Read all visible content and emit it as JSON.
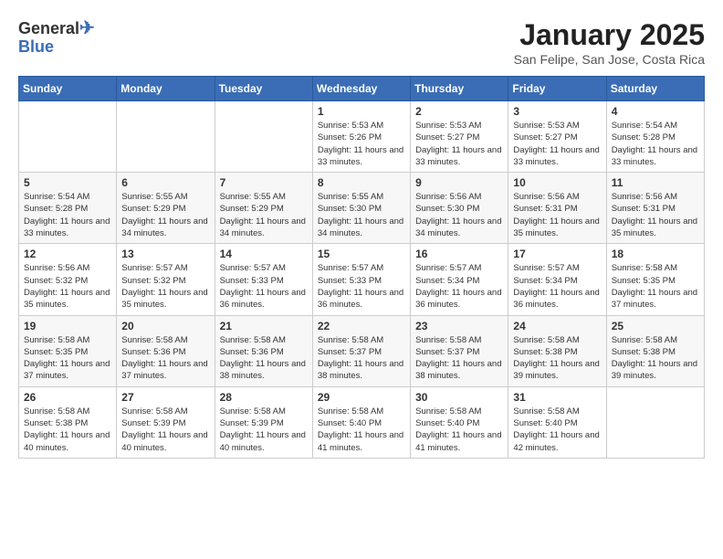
{
  "header": {
    "logo_line1": "General",
    "logo_line2": "Blue",
    "month_title": "January 2025",
    "subtitle": "San Felipe, San Jose, Costa Rica"
  },
  "weekdays": [
    "Sunday",
    "Monday",
    "Tuesday",
    "Wednesday",
    "Thursday",
    "Friday",
    "Saturday"
  ],
  "weeks": [
    [
      {
        "day": "",
        "info": ""
      },
      {
        "day": "",
        "info": ""
      },
      {
        "day": "",
        "info": ""
      },
      {
        "day": "1",
        "info": "Sunrise: 5:53 AM\nSunset: 5:26 PM\nDaylight: 11 hours\nand 33 minutes."
      },
      {
        "day": "2",
        "info": "Sunrise: 5:53 AM\nSunset: 5:27 PM\nDaylight: 11 hours\nand 33 minutes."
      },
      {
        "day": "3",
        "info": "Sunrise: 5:53 AM\nSunset: 5:27 PM\nDaylight: 11 hours\nand 33 minutes."
      },
      {
        "day": "4",
        "info": "Sunrise: 5:54 AM\nSunset: 5:28 PM\nDaylight: 11 hours\nand 33 minutes."
      }
    ],
    [
      {
        "day": "5",
        "info": "Sunrise: 5:54 AM\nSunset: 5:28 PM\nDaylight: 11 hours\nand 33 minutes."
      },
      {
        "day": "6",
        "info": "Sunrise: 5:55 AM\nSunset: 5:29 PM\nDaylight: 11 hours\nand 34 minutes."
      },
      {
        "day": "7",
        "info": "Sunrise: 5:55 AM\nSunset: 5:29 PM\nDaylight: 11 hours\nand 34 minutes."
      },
      {
        "day": "8",
        "info": "Sunrise: 5:55 AM\nSunset: 5:30 PM\nDaylight: 11 hours\nand 34 minutes."
      },
      {
        "day": "9",
        "info": "Sunrise: 5:56 AM\nSunset: 5:30 PM\nDaylight: 11 hours\nand 34 minutes."
      },
      {
        "day": "10",
        "info": "Sunrise: 5:56 AM\nSunset: 5:31 PM\nDaylight: 11 hours\nand 35 minutes."
      },
      {
        "day": "11",
        "info": "Sunrise: 5:56 AM\nSunset: 5:31 PM\nDaylight: 11 hours\nand 35 minutes."
      }
    ],
    [
      {
        "day": "12",
        "info": "Sunrise: 5:56 AM\nSunset: 5:32 PM\nDaylight: 11 hours\nand 35 minutes."
      },
      {
        "day": "13",
        "info": "Sunrise: 5:57 AM\nSunset: 5:32 PM\nDaylight: 11 hours\nand 35 minutes."
      },
      {
        "day": "14",
        "info": "Sunrise: 5:57 AM\nSunset: 5:33 PM\nDaylight: 11 hours\nand 36 minutes."
      },
      {
        "day": "15",
        "info": "Sunrise: 5:57 AM\nSunset: 5:33 PM\nDaylight: 11 hours\nand 36 minutes."
      },
      {
        "day": "16",
        "info": "Sunrise: 5:57 AM\nSunset: 5:34 PM\nDaylight: 11 hours\nand 36 minutes."
      },
      {
        "day": "17",
        "info": "Sunrise: 5:57 AM\nSunset: 5:34 PM\nDaylight: 11 hours\nand 36 minutes."
      },
      {
        "day": "18",
        "info": "Sunrise: 5:58 AM\nSunset: 5:35 PM\nDaylight: 11 hours\nand 37 minutes."
      }
    ],
    [
      {
        "day": "19",
        "info": "Sunrise: 5:58 AM\nSunset: 5:35 PM\nDaylight: 11 hours\nand 37 minutes."
      },
      {
        "day": "20",
        "info": "Sunrise: 5:58 AM\nSunset: 5:36 PM\nDaylight: 11 hours\nand 37 minutes."
      },
      {
        "day": "21",
        "info": "Sunrise: 5:58 AM\nSunset: 5:36 PM\nDaylight: 11 hours\nand 38 minutes."
      },
      {
        "day": "22",
        "info": "Sunrise: 5:58 AM\nSunset: 5:37 PM\nDaylight: 11 hours\nand 38 minutes."
      },
      {
        "day": "23",
        "info": "Sunrise: 5:58 AM\nSunset: 5:37 PM\nDaylight: 11 hours\nand 38 minutes."
      },
      {
        "day": "24",
        "info": "Sunrise: 5:58 AM\nSunset: 5:38 PM\nDaylight: 11 hours\nand 39 minutes."
      },
      {
        "day": "25",
        "info": "Sunrise: 5:58 AM\nSunset: 5:38 PM\nDaylight: 11 hours\nand 39 minutes."
      }
    ],
    [
      {
        "day": "26",
        "info": "Sunrise: 5:58 AM\nSunset: 5:38 PM\nDaylight: 11 hours\nand 40 minutes."
      },
      {
        "day": "27",
        "info": "Sunrise: 5:58 AM\nSunset: 5:39 PM\nDaylight: 11 hours\nand 40 minutes."
      },
      {
        "day": "28",
        "info": "Sunrise: 5:58 AM\nSunset: 5:39 PM\nDaylight: 11 hours\nand 40 minutes."
      },
      {
        "day": "29",
        "info": "Sunrise: 5:58 AM\nSunset: 5:40 PM\nDaylight: 11 hours\nand 41 minutes."
      },
      {
        "day": "30",
        "info": "Sunrise: 5:58 AM\nSunset: 5:40 PM\nDaylight: 11 hours\nand 41 minutes."
      },
      {
        "day": "31",
        "info": "Sunrise: 5:58 AM\nSunset: 5:40 PM\nDaylight: 11 hours\nand 42 minutes."
      },
      {
        "day": "",
        "info": ""
      }
    ]
  ]
}
